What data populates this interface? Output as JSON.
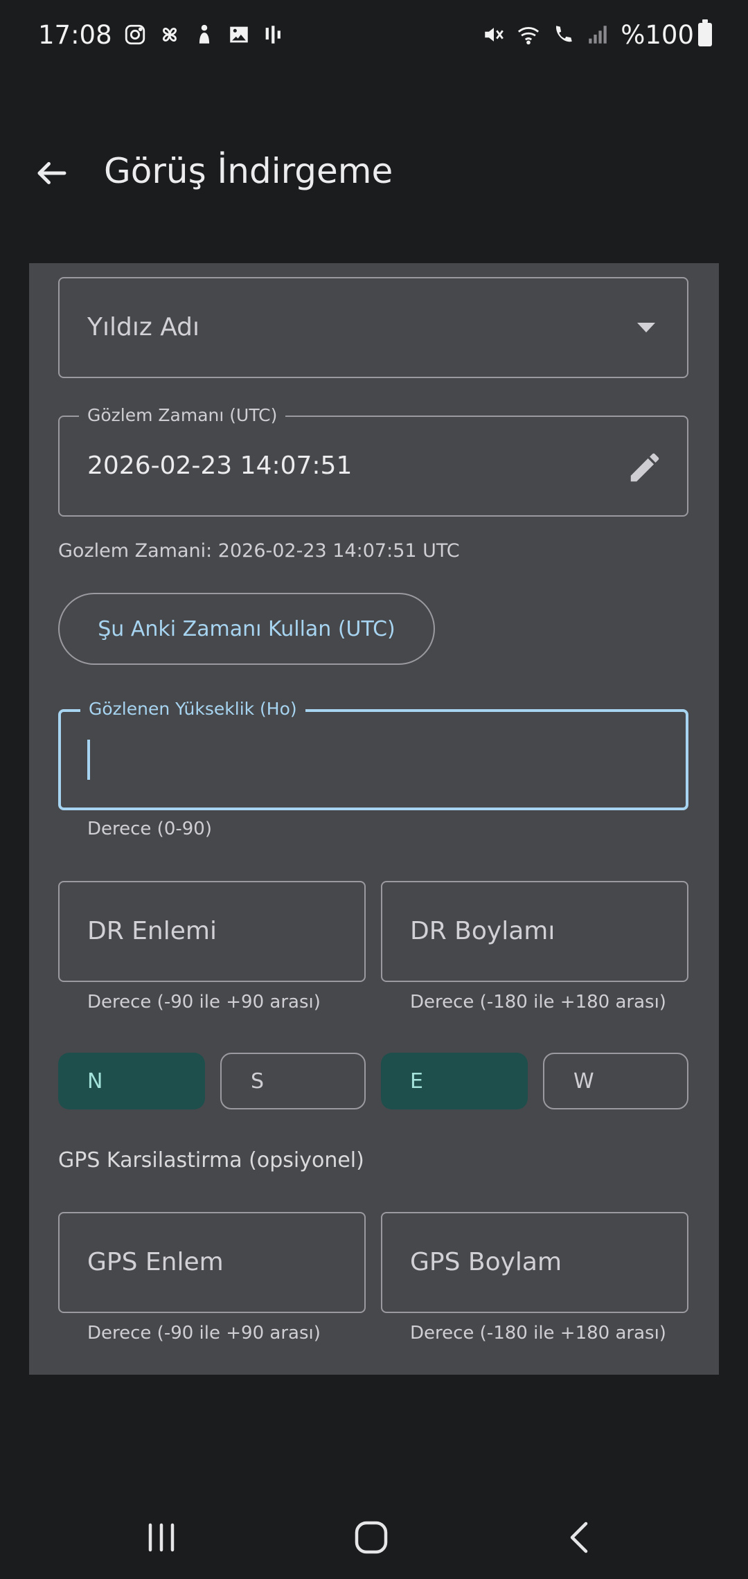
{
  "status_bar": {
    "time": "17:08",
    "battery": "%100",
    "left_icons": [
      "instagram-icon",
      "pinwheel-icon",
      "figure-icon",
      "gallery-icon",
      "audio-bars-icon"
    ],
    "right_icons": [
      "mute-icon",
      "wifi-icon",
      "wifi-call-icon",
      "signal-icon",
      "battery-icon"
    ]
  },
  "app_bar": {
    "title": "Görüş İndirgeme",
    "back_icon": "arrow-left-icon"
  },
  "form": {
    "star_name": {
      "placeholder": "Yıldız Adı"
    },
    "obs_time": {
      "label": "Gözlem Zamanı (UTC)",
      "value": "2026-02-23 14:07:51"
    },
    "obs_time_helper": "Gozlem Zamani: 2026-02-23 14:07:51 UTC",
    "use_now_button": "Şu Anki Zamanı Kullan (UTC)",
    "observed_altitude": {
      "label": "Gözlenen Yükseklik (Ho)",
      "value": "",
      "helper": "Derece (0-90)"
    },
    "dr_lat": {
      "placeholder": "DR Enlemi",
      "helper": "Derece (-90 ile +90 arası)"
    },
    "dr_lon": {
      "placeholder": "DR Boylamı",
      "helper": "Derece (-180 ile +180 arası)"
    },
    "hemisphere_ns": [
      {
        "label": "N",
        "selected": true
      },
      {
        "label": "S",
        "selected": false
      }
    ],
    "hemisphere_ew": [
      {
        "label": "E",
        "selected": true
      },
      {
        "label": "W",
        "selected": false
      }
    ],
    "gps_section_label": "GPS Karsilastirma (opsiyonel)",
    "gps_lat": {
      "placeholder": "GPS Enlem",
      "helper": "Derece (-90 ile +90 arası)"
    },
    "gps_lon": {
      "placeholder": "GPS Boylam",
      "helper": "Derece (-180 ile +180 arası)"
    }
  },
  "colors": {
    "background": "#1b1c1e",
    "card": "#47484b",
    "accent": "#a7d4f0",
    "segment_selected": "#1f4f4d",
    "segment_selected_text": "#a3e3dc"
  },
  "nav_bar": {
    "recents_icon": "recents-icon",
    "home_icon": "home-icon",
    "back_icon": "nav-back-icon"
  }
}
